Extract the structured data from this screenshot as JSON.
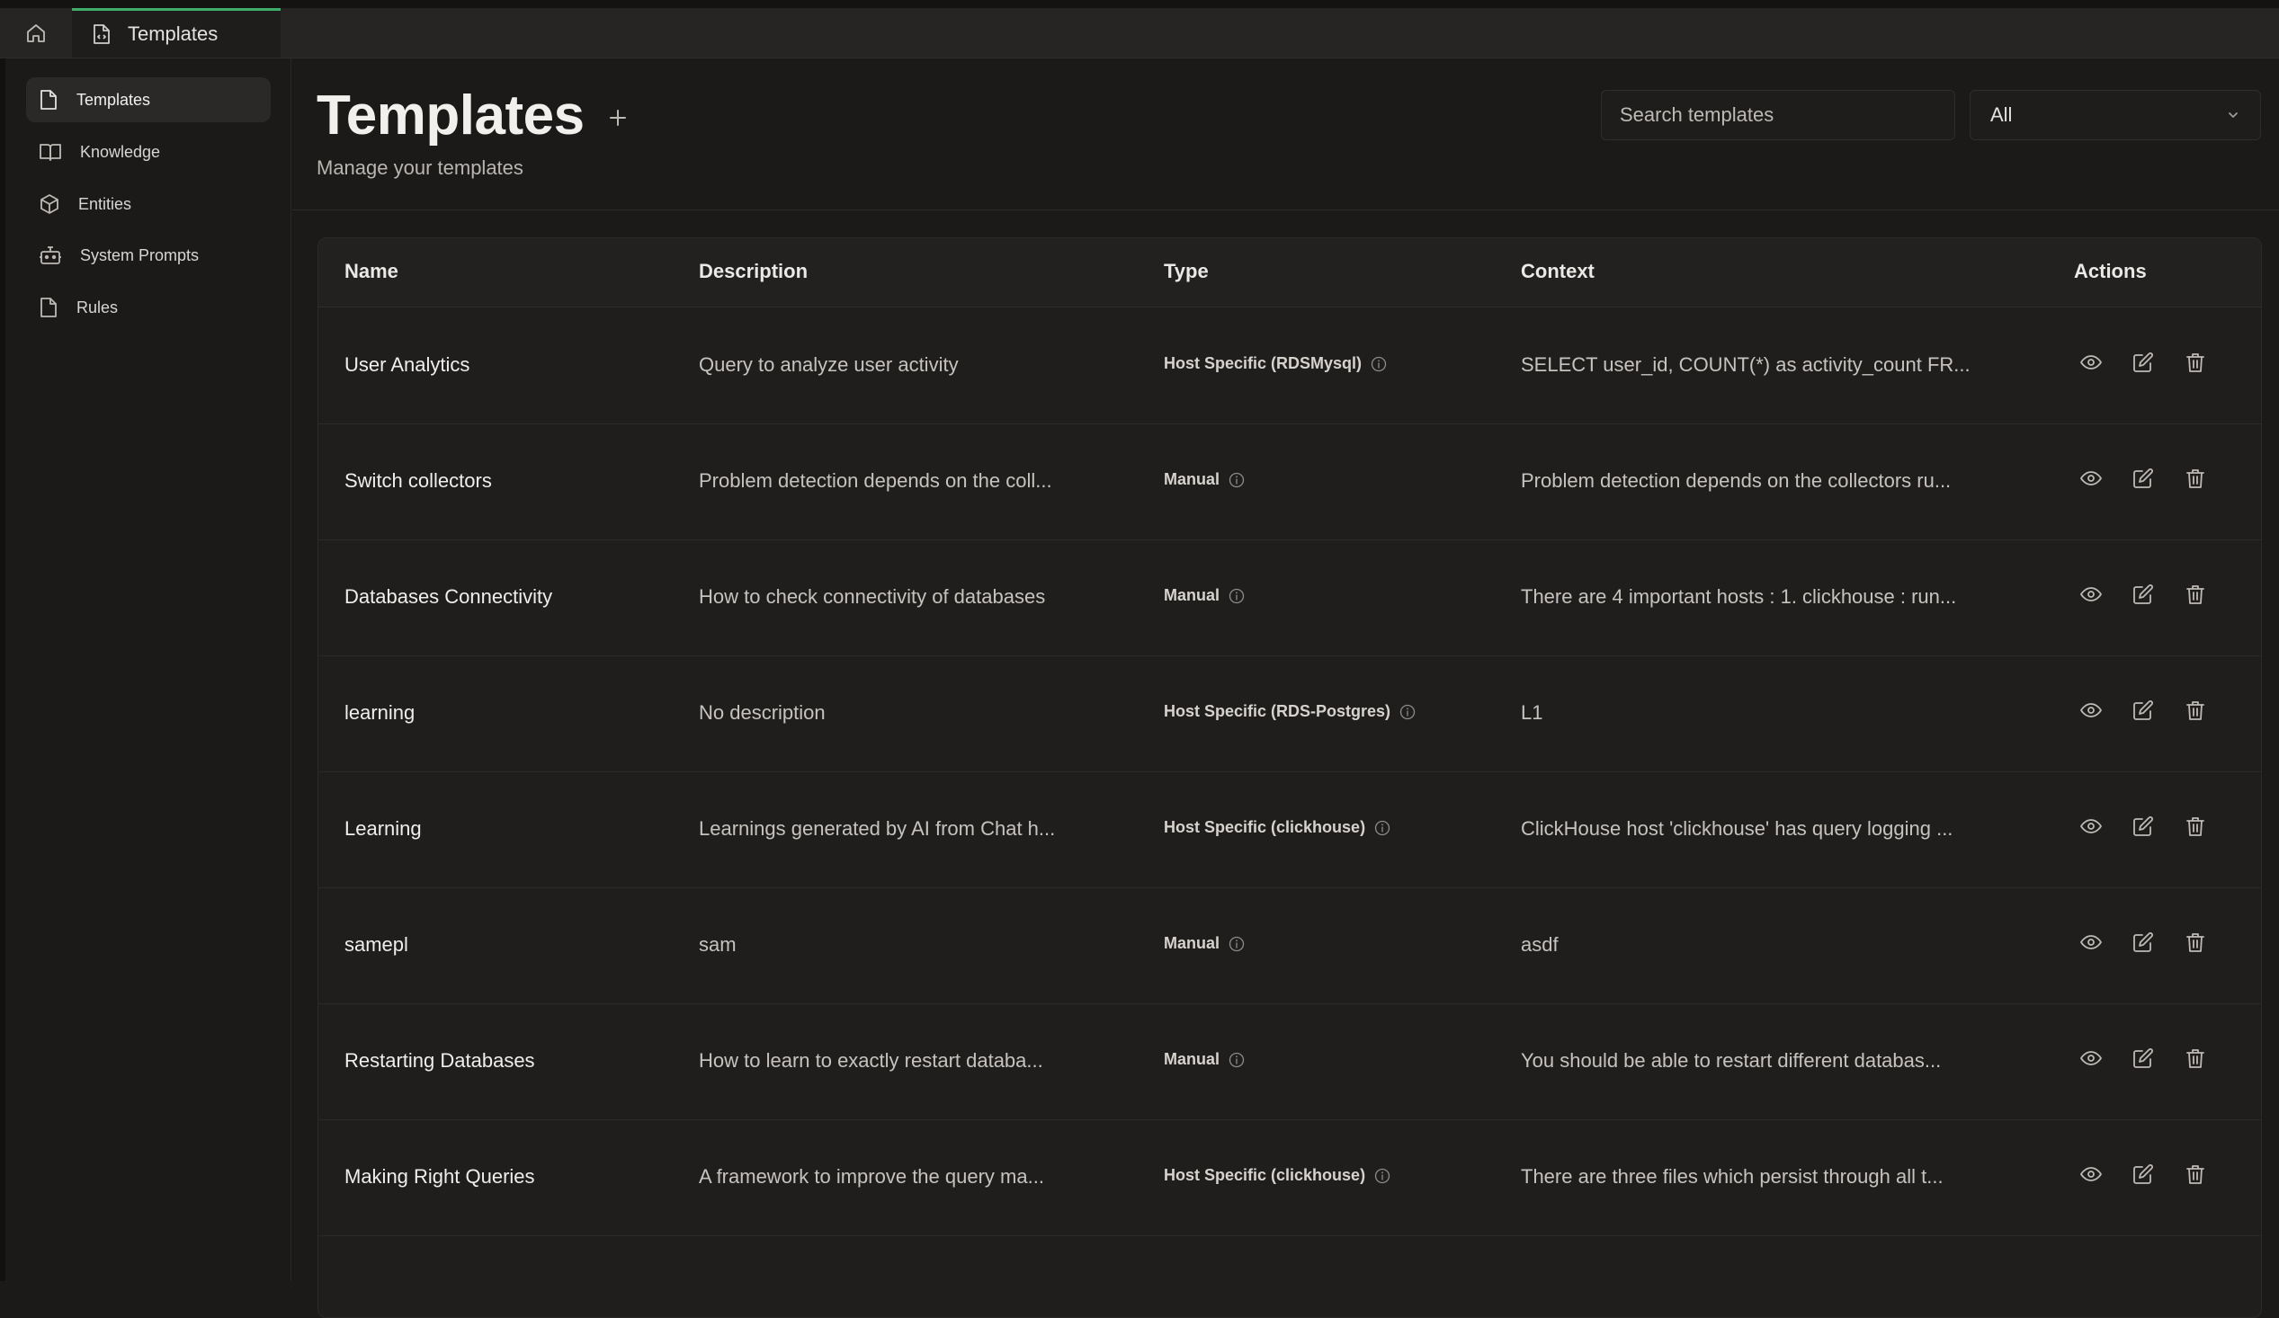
{
  "tab": {
    "title": "Templates"
  },
  "sidebar": {
    "items": [
      {
        "label": "Templates",
        "icon": "file-icon",
        "active": true
      },
      {
        "label": "Knowledge",
        "icon": "book-icon",
        "active": false
      },
      {
        "label": "Entities",
        "icon": "box-icon",
        "active": false
      },
      {
        "label": "System Prompts",
        "icon": "bot-icon",
        "active": false
      },
      {
        "label": "Rules",
        "icon": "file-icon",
        "active": false
      }
    ]
  },
  "header": {
    "title": "Templates",
    "subtitle": "Manage your templates",
    "search_placeholder": "Search templates",
    "filter_value": "All"
  },
  "table": {
    "columns": {
      "name": "Name",
      "description": "Description",
      "type": "Type",
      "context": "Context",
      "actions": "Actions"
    },
    "rows": [
      {
        "name": "User Analytics",
        "description": "Query to analyze user activity",
        "type": "Host Specific (RDSMysql)",
        "context": "SELECT user_id, COUNT(*) as activity_count FR..."
      },
      {
        "name": "Switch collectors",
        "description": "Problem detection depends on the coll...",
        "type": "Manual",
        "context": "Problem detection depends on the collectors ru..."
      },
      {
        "name": "Databases Connectivity",
        "description": "How to check connectivity of databases",
        "type": "Manual",
        "context": "There are 4 important hosts : 1. clickhouse : run..."
      },
      {
        "name": "learning",
        "description": "No description",
        "type": "Host Specific (RDS-Postgres)",
        "context": "L1"
      },
      {
        "name": "Learning",
        "description": "Learnings generated by AI from Chat h...",
        "type": "Host Specific (clickhouse)",
        "context": "ClickHouse host 'clickhouse' has query logging ..."
      },
      {
        "name": "samepl",
        "description": "sam",
        "type": "Manual",
        "context": "asdf"
      },
      {
        "name": "Restarting Databases",
        "description": "How to learn to exactly restart databa...",
        "type": "Manual",
        "context": "You should be able to restart different databas..."
      },
      {
        "name": "Making Right Queries",
        "description": "A framework to improve the query ma...",
        "type": "Host Specific (clickhouse)",
        "context": "There are three files which persist through all t..."
      }
    ]
  },
  "colors": {
    "accent": "#3fae6a",
    "background": "#1c1a19",
    "panel": "#201e1d"
  }
}
